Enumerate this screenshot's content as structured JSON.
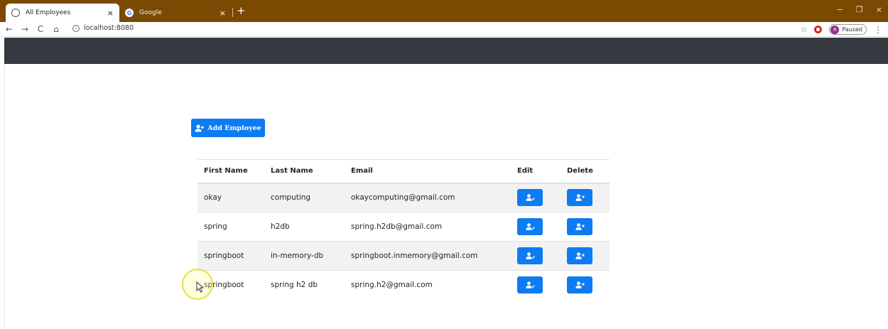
{
  "browser": {
    "tabs": [
      {
        "title": "All Employees",
        "close": "×"
      },
      {
        "title": "Google",
        "close": "×"
      }
    ],
    "new_tab": "+",
    "window_controls": [
      "−",
      "❐",
      "×"
    ],
    "nav": {
      "back": "←",
      "forward": "→",
      "reload": "C",
      "home": "⌂"
    },
    "url": "localhost:8080",
    "profile_initial": "R",
    "profile_status": "Paused"
  },
  "page": {
    "add_button_label": "Add Employee",
    "accent_color": "#0d7bf2",
    "navbar_color": "#343a40",
    "table": {
      "headers": [
        "First Name",
        "Last Name",
        "Email",
        "Edit",
        "Delete"
      ],
      "rows": [
        {
          "first": "okay",
          "last": "computing",
          "email": "okaycomputing@gmail.com"
        },
        {
          "first": "spring",
          "last": "h2db",
          "email": "spring.h2db@gmail.com"
        },
        {
          "first": "springboot",
          "last": "in-memory-db",
          "email": "springboot.inmemory@gmail.com"
        },
        {
          "first": "springboot",
          "last": "spring h2 db",
          "email": "spring.h2@gmail.com"
        }
      ],
      "edit_icon": "user-edit-icon",
      "delete_icon": "user-times-icon"
    }
  }
}
